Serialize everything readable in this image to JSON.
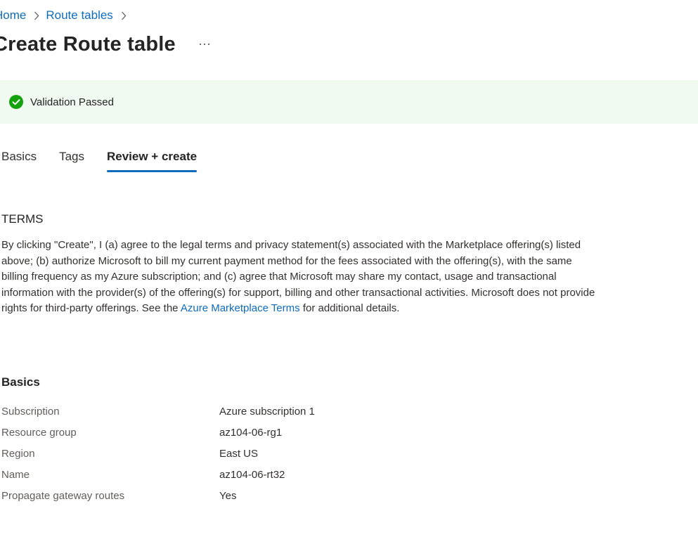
{
  "breadcrumb": {
    "items": [
      {
        "label": "Home"
      },
      {
        "label": "Route tables"
      }
    ]
  },
  "title": "Create Route table",
  "more_label": "...",
  "banner": {
    "text": "Validation Passed",
    "icon": "checkmark-circle-icon",
    "color": "#13a10e",
    "background": "#f1faf1"
  },
  "tabs": [
    {
      "label": "Basics",
      "active": false
    },
    {
      "label": "Tags",
      "active": false
    },
    {
      "label": "Review + create",
      "active": true
    }
  ],
  "terms": {
    "heading": "TERMS",
    "body_before": "By clicking \"Create\", I (a) agree to the legal terms and privacy statement(s) associated with the Marketplace offering(s) listed above; (b) authorize Microsoft to bill my current payment method for the fees associated with the offering(s), with the same billing frequency as my Azure subscription; and (c) agree that Microsoft may share my contact, usage and transactional information with the provider(s) of the offering(s) for support, billing and other transactional activities. Microsoft does not provide rights for third-party offerings. See the ",
    "link_text": "Azure Marketplace Terms",
    "body_after": " for additional details."
  },
  "basics": {
    "heading": "Basics",
    "rows": [
      {
        "label": "Subscription",
        "value": "Azure subscription 1"
      },
      {
        "label": "Resource group",
        "value": "az104-06-rg1"
      },
      {
        "label": "Region",
        "value": "East US"
      },
      {
        "label": "Name",
        "value": "az104-06-rt32"
      },
      {
        "label": "Propagate gateway routes",
        "value": "Yes"
      }
    ]
  },
  "colors": {
    "link": "#0f6cbd",
    "success": "#13a10e",
    "tab_underline": "#0f6cbd"
  }
}
